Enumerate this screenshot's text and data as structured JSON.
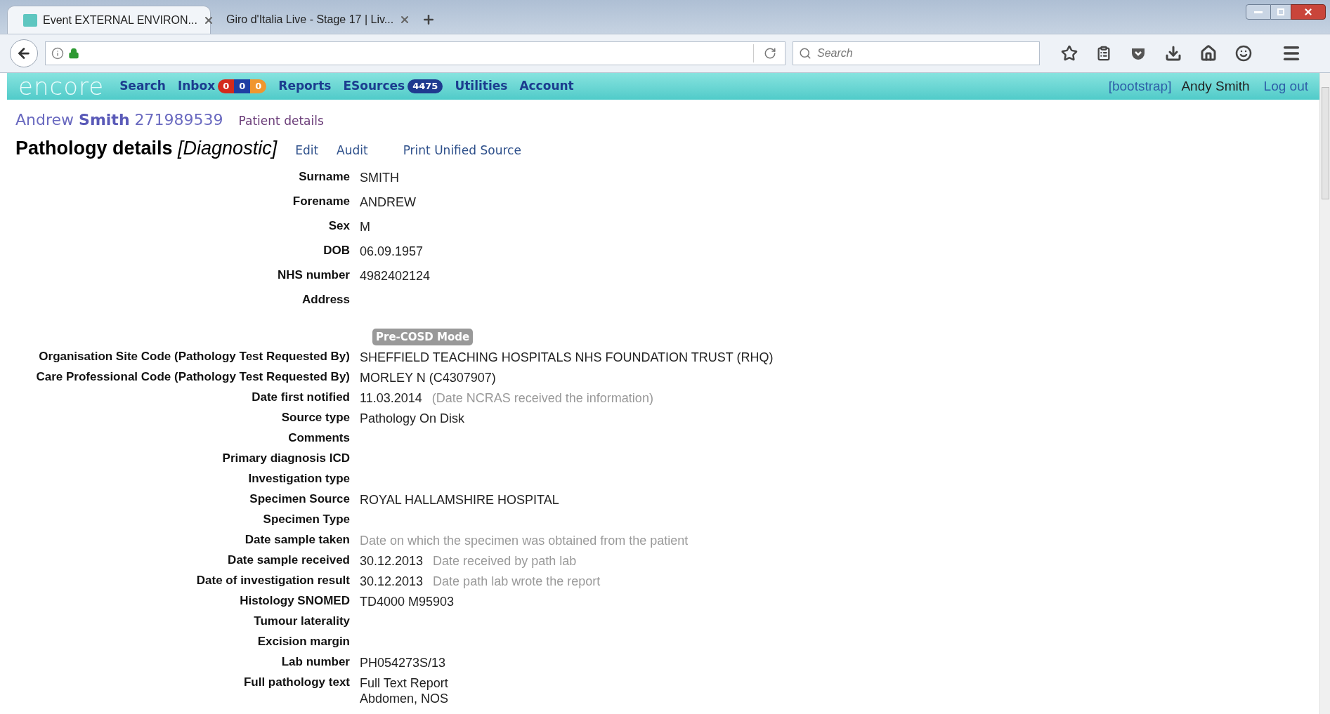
{
  "browser": {
    "tabs": [
      {
        "title": "Event EXTERNAL ENVIRON...",
        "selected": true
      },
      {
        "title": "Giro d'Italia Live - Stage 17 | Liv...",
        "selected": false
      }
    ],
    "search": {
      "placeholder": "Search"
    }
  },
  "nav": {
    "logo": "encore",
    "items": [
      {
        "label": "Search"
      },
      {
        "label": "Inbox",
        "badges": [
          {
            "text": "0",
            "color": "#d42a1c"
          },
          {
            "text": "0",
            "color": "#1f3fa3"
          },
          {
            "text": "0",
            "color": "#f0962e"
          }
        ]
      },
      {
        "label": "Reports"
      },
      {
        "label": "ESources",
        "badges": [
          {
            "text": "4475",
            "color": "#1f3a8f"
          }
        ]
      },
      {
        "label": "Utilities"
      },
      {
        "label": "Account"
      }
    ],
    "bootstrap": "[bootstrap]",
    "user": "Andy Smith",
    "logout": "Log out"
  },
  "patient": {
    "forename": "Andrew",
    "surname": "Smith",
    "number": "271989539",
    "link": "Patient details"
  },
  "heading": {
    "title": "Pathology details",
    "qualifier": "[Diagnostic]",
    "actions": [
      "Edit",
      "Audit",
      "Print Unified Source"
    ]
  },
  "demographics": [
    {
      "label": "Surname",
      "value": "SMITH"
    },
    {
      "label": "Forename",
      "value": "ANDREW"
    },
    {
      "label": "Sex",
      "value": "M"
    },
    {
      "label": "DOB",
      "value": "06.09.1957"
    },
    {
      "label": "NHS number",
      "value": "4982402124"
    },
    {
      "label": "Address"
    }
  ],
  "mode_badge": "Pre-COSD Mode",
  "pathology": [
    {
      "label": "Organisation Site Code (Pathology Test Requested By)",
      "value": "SHEFFIELD TEACHING HOSPITALS NHS FOUNDATION TRUST (RHQ)"
    },
    {
      "label": "Care Professional Code (Pathology Test Requested By)",
      "value": "MORLEY N (C4307907)"
    },
    {
      "label": "Date first notified",
      "value": "11.03.2014",
      "hint": "(Date NCRAS received the information)"
    },
    {
      "label": "Source type",
      "value": "Pathology On Disk"
    },
    {
      "label": "Comments"
    },
    {
      "label": "Primary diagnosis ICD"
    },
    {
      "label": "Investigation type"
    },
    {
      "label": "Specimen Source",
      "value": "ROYAL HALLAMSHIRE HOSPITAL"
    },
    {
      "label": "Specimen Type"
    },
    {
      "label": "Date sample taken",
      "hint": "Date on which the specimen was obtained from the patient"
    },
    {
      "label": "Date sample received",
      "value": "30.12.2013",
      "hint": "Date received by path lab"
    },
    {
      "label": "Date of investigation result",
      "value": "30.12.2013",
      "hint": "Date path lab wrote the report"
    },
    {
      "label": "Histology SNOMED",
      "value": "TD4000 M95903"
    },
    {
      "label": "Tumour laterality"
    },
    {
      "label": "Excision margin"
    },
    {
      "label": "Lab number",
      "value": "PH054273S/13"
    },
    {
      "label": "Full pathology text",
      "value": "Full Text Report",
      "more": [
        "Abdomen, NOS"
      ]
    }
  ]
}
